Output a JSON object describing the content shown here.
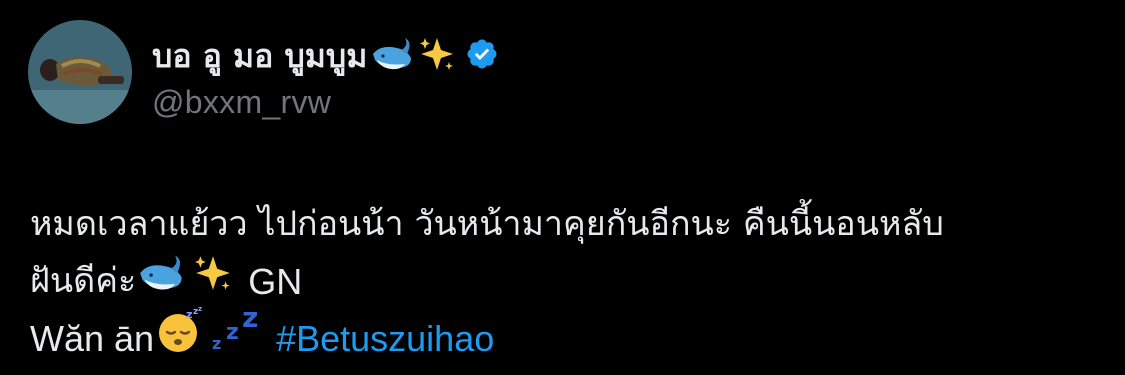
{
  "tweet": {
    "author": {
      "display_name": "บอ อู มอ บูมบูม",
      "handle": "@bxxm_rvw",
      "name_emojis": [
        "whale-emoji",
        "sparkles-emoji"
      ],
      "verified": true
    },
    "text": {
      "line1": "หมดเวลาแย้วว ไปก่อนน้า วันหน้ามาคุยกันอีกนะ คืนนี้นอนหลับ",
      "line2_thai": "ฝันดีค่ะ",
      "line2_latin": "GN",
      "line3_text": "Wăn ān",
      "line3_hashtag": "#Betuszuihao"
    }
  },
  "colors": {
    "background": "#000000",
    "text_primary": "#e7e9ea",
    "text_secondary": "#71767b",
    "link": "#1d9bf0",
    "verified": "#1d9bf0"
  }
}
